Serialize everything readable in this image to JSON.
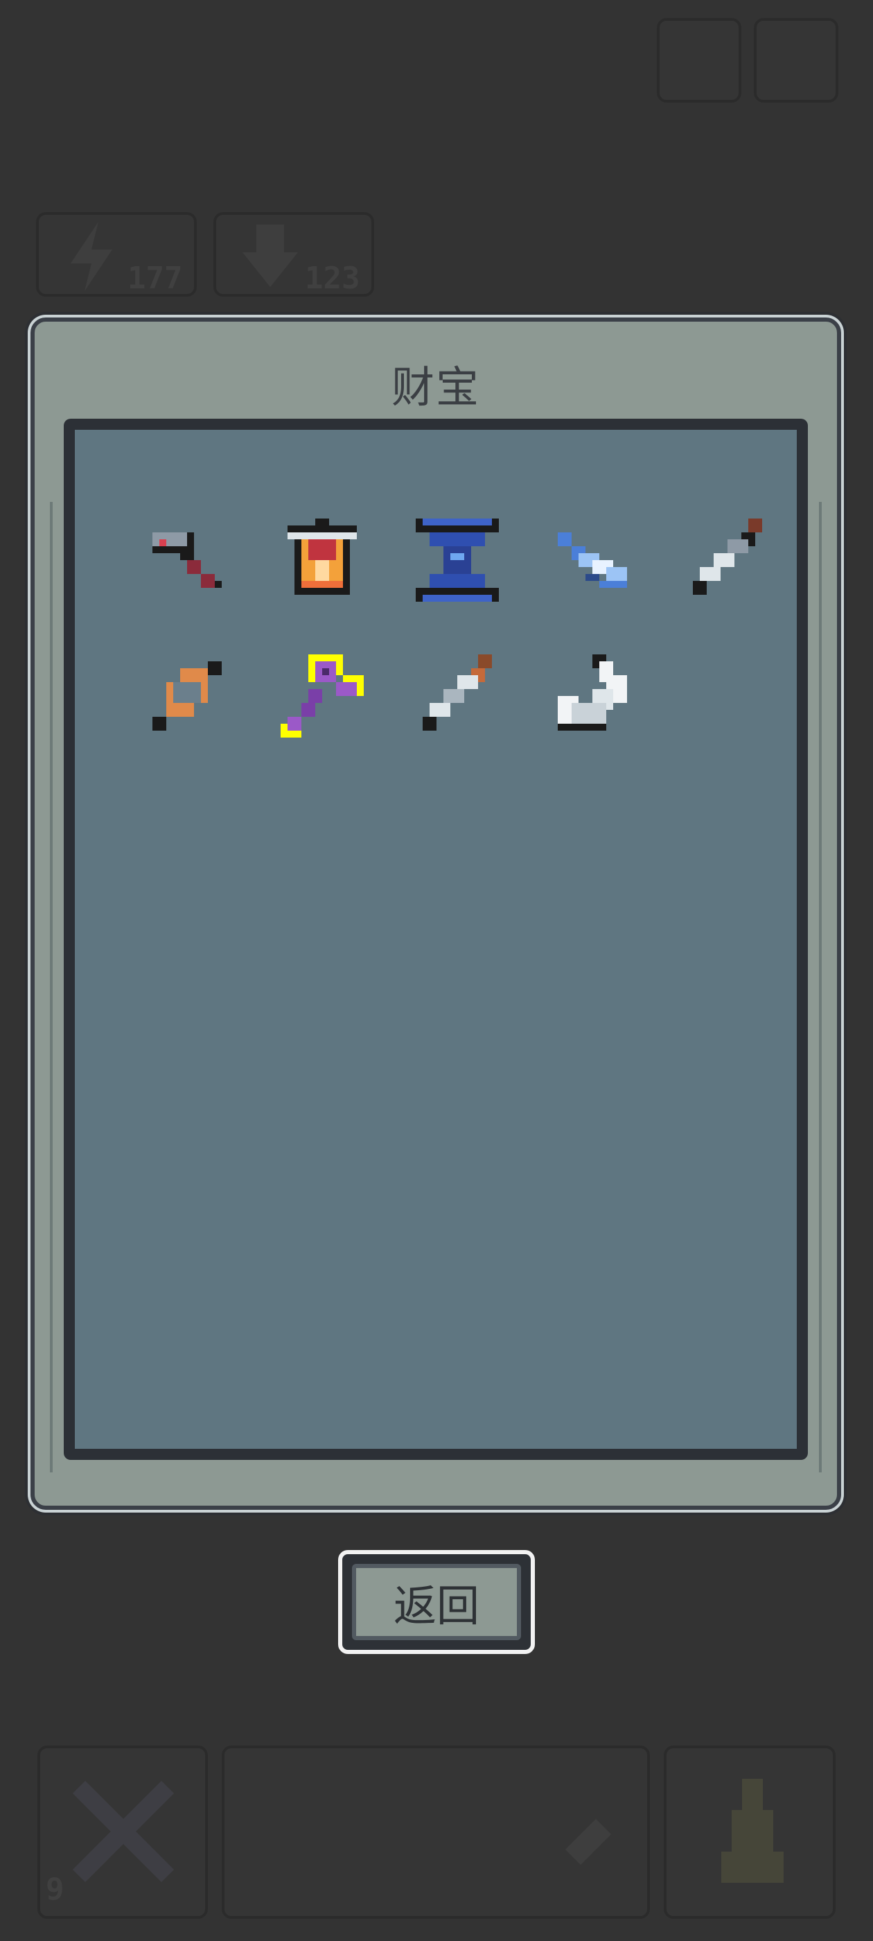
{
  "hud": {
    "energy_value": "177",
    "download_value": "123",
    "bottom_left_count": "9"
  },
  "panel": {
    "title": "财宝"
  },
  "treasure_items": [
    {
      "icon": "hammer-icon",
      "selected": false
    },
    {
      "icon": "lantern-icon",
      "selected": false
    },
    {
      "icon": "hourglass-icon",
      "selected": false
    },
    {
      "icon": "ice-blade-icon",
      "selected": false
    },
    {
      "icon": "dagger-icon",
      "selected": false
    },
    {
      "icon": "gem-amulet-icon",
      "selected": false
    },
    {
      "icon": "purple-key-icon",
      "selected": true
    },
    {
      "icon": "sword-icon",
      "selected": false
    },
    {
      "icon": "feather-wing-icon",
      "selected": false
    }
  ],
  "back_button": {
    "label": "返回"
  },
  "colors": {
    "background": "#333333",
    "panel_frame": "#8d9993",
    "panel_inner": "#5f7681",
    "selection": "#ffff00"
  }
}
